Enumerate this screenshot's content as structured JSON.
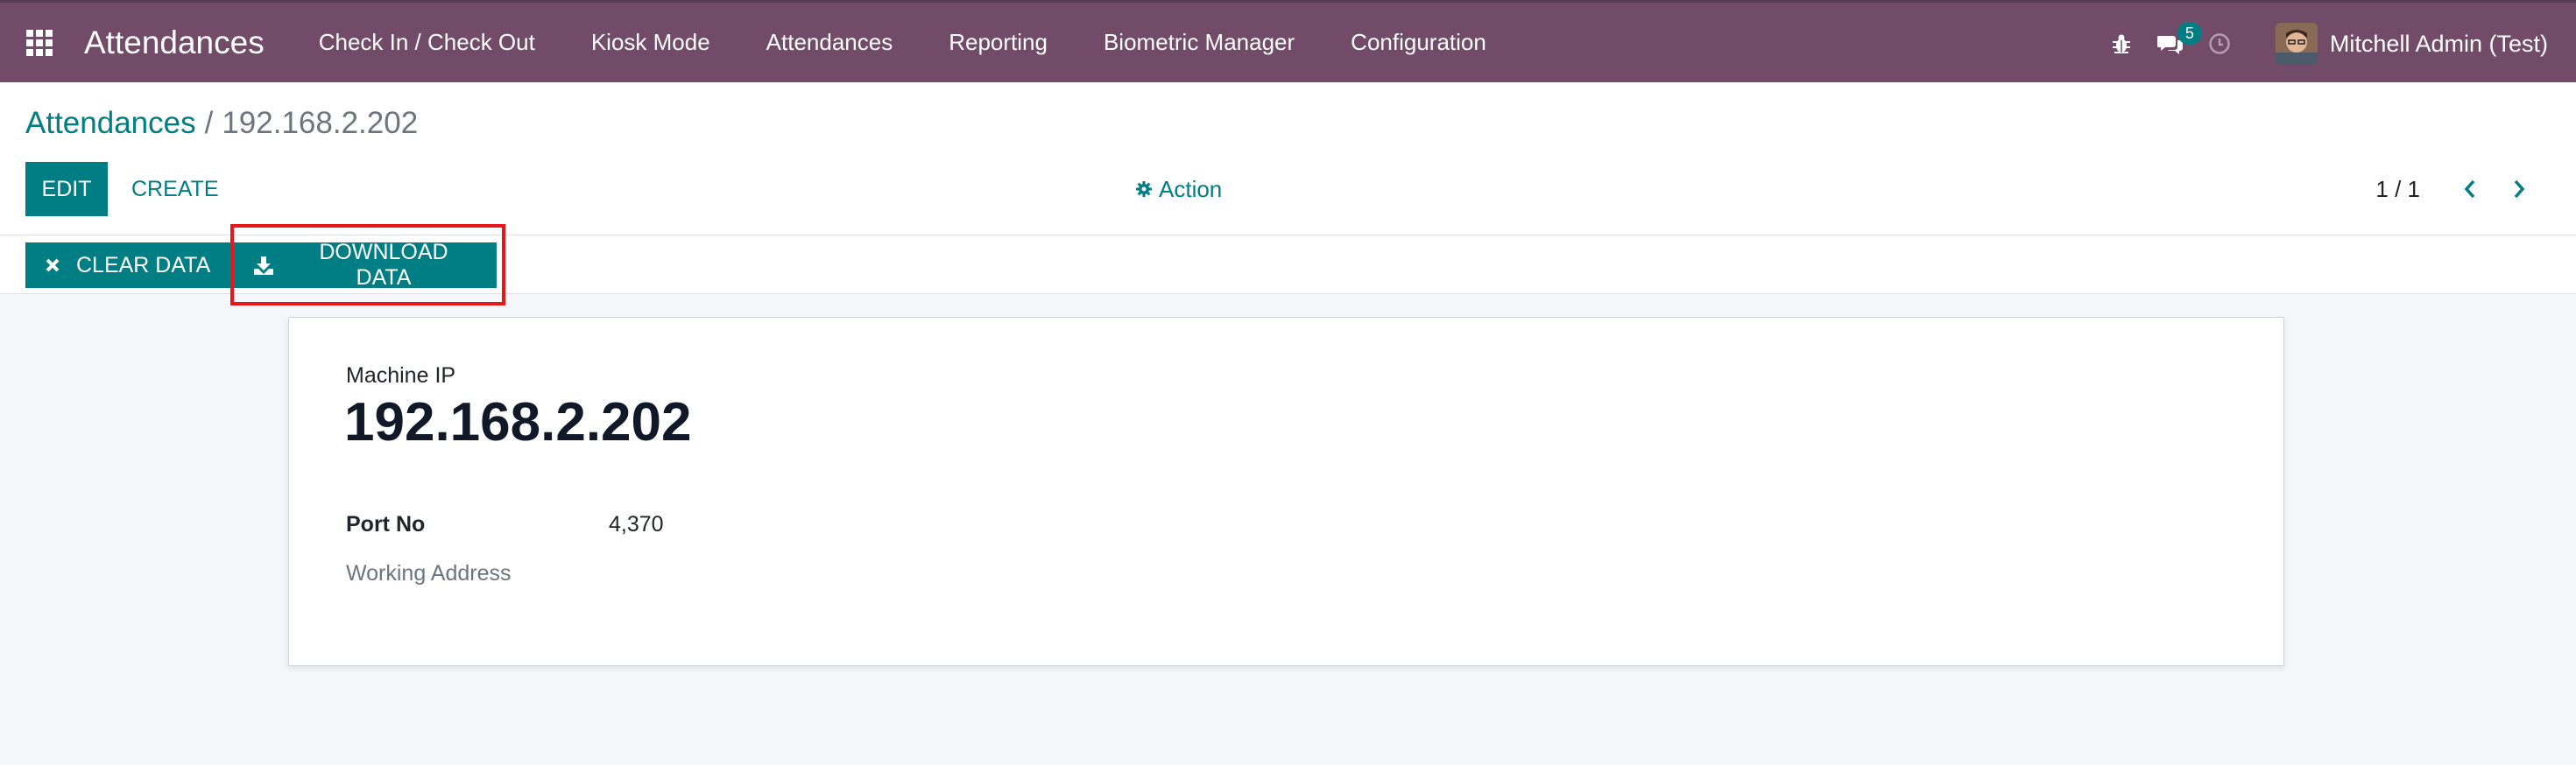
{
  "navbar": {
    "app_title": "Attendances",
    "menu": [
      "Check In / Check Out",
      "Kiosk Mode",
      "Attendances",
      "Reporting",
      "Biometric Manager",
      "Configuration"
    ],
    "messages_count": "5",
    "user_name": "Mitchell Admin (Test)",
    "bg_color": "#714b67"
  },
  "breadcrumb": {
    "parent": "Attendances",
    "separator": "/",
    "current": "192.168.2.202"
  },
  "toolbar": {
    "edit_label": "EDIT",
    "create_label": "CREATE",
    "action_label": "Action",
    "pager": "1 / 1"
  },
  "statusbar": {
    "clear_label": "CLEAR DATA",
    "download_label": "DOWNLOAD DATA"
  },
  "form": {
    "machine_ip_label": "Machine IP",
    "machine_ip_value": "192.168.2.202",
    "port_label": "Port No",
    "port_value": "4,370",
    "address_label": "Working Address"
  },
  "colors": {
    "primary": "#017e84",
    "highlight": "#e8161b"
  },
  "icons": {
    "apps": "apps-grid-icon",
    "debug": "bug-icon",
    "messages": "chat-icon",
    "activities": "clock-icon",
    "action": "gear-icon",
    "clear": "close-icon",
    "download": "download-icon"
  }
}
